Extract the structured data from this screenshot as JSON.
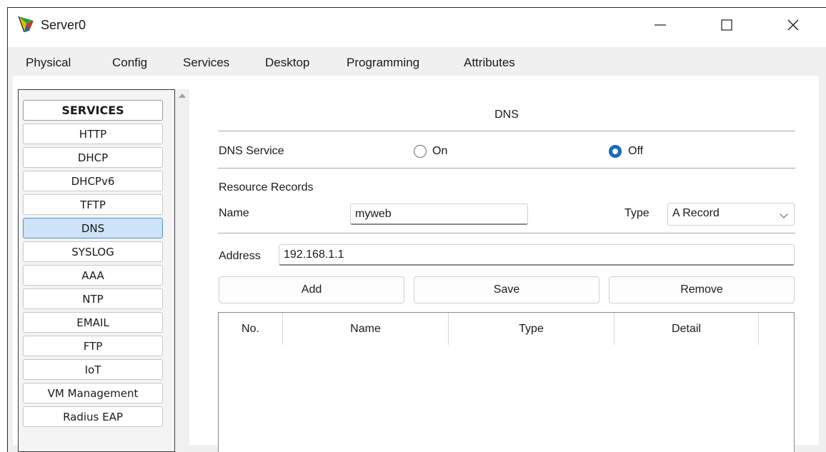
{
  "window": {
    "title": "Server0",
    "app_icon": "packet-tracer-server-icon"
  },
  "tabs": [
    {
      "label": "Physical"
    },
    {
      "label": "Config"
    },
    {
      "label": "Services",
      "active": true
    },
    {
      "label": "Desktop"
    },
    {
      "label": "Programming"
    },
    {
      "label": "Attributes"
    }
  ],
  "services": {
    "header": "SERVICES",
    "items": [
      "HTTP",
      "DHCP",
      "DHCPv6",
      "TFTP",
      "DNS",
      "SYSLOG",
      "AAA",
      "NTP",
      "EMAIL",
      "FTP",
      "IoT",
      "VM Management",
      "Radius EAP"
    ],
    "selected": "DNS"
  },
  "dns": {
    "title": "DNS",
    "service_label": "DNS Service",
    "on_label": "On",
    "off_label": "Off",
    "service_state": "Off",
    "resource_records_label": "Resource Records",
    "name_label": "Name",
    "name_value": "myweb",
    "type_label": "Type",
    "type_value": "A Record",
    "address_label": "Address",
    "address_value": "192.168.1.1",
    "add_label": "Add",
    "save_label": "Save",
    "remove_label": "Remove",
    "table_columns": [
      "No.",
      "Name",
      "Type",
      "Detail"
    ]
  },
  "colors": {
    "accent": "#1668c4",
    "selected_bg": "#cde3f7",
    "tab_underline": "#1d2b4a"
  }
}
